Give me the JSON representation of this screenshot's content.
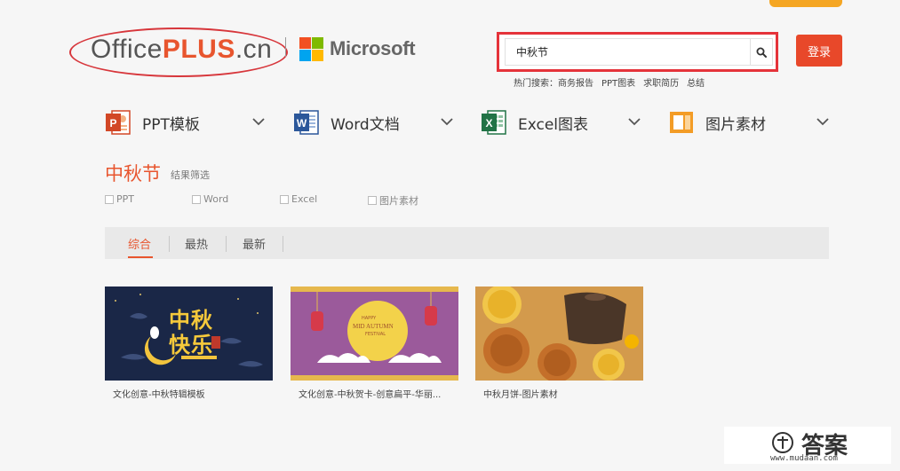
{
  "header": {
    "logo": {
      "office": "Office",
      "plus": "PLUS",
      "cn": ".cn"
    },
    "microsoft_label": "Microsoft",
    "search": {
      "value": "中秋节"
    },
    "hot_searches": {
      "label": "热门搜索：",
      "items": [
        "商务报告",
        "PPT图表",
        "求职简历",
        "总结"
      ]
    },
    "login_label": "登录"
  },
  "categories": [
    {
      "label": "PPT模板",
      "icon": "powerpoint-icon"
    },
    {
      "label": "Word文档",
      "icon": "word-icon"
    },
    {
      "label": "Excel图表",
      "icon": "excel-icon"
    },
    {
      "label": "图片素材",
      "icon": "image-material-icon"
    }
  ],
  "results": {
    "title": "中秋节",
    "subtitle": "结果筛选",
    "filters": [
      "PPT",
      "Word",
      "Excel",
      "图片素材"
    ],
    "tabs": [
      "综合",
      "最热",
      "最新"
    ],
    "active_tab": "综合",
    "cards": [
      {
        "label": "文化创意-中秋特辑模板",
        "thumb_text_1": "中秋",
        "thumb_text_2": "快乐"
      },
      {
        "label": "文化创意-中秋贺卡-创意扁平-华丽...",
        "thumb_text_1": "HAPPY",
        "thumb_text_2": "MID AUTUMN",
        "thumb_text_3": "FESTIVAL"
      },
      {
        "label": "中秋月饼-图片素材"
      }
    ]
  },
  "watermark": {
    "text": "答案",
    "url": "www.mudaan.com"
  },
  "colors": {
    "accent": "#e8552e",
    "highlight": "#e5333a",
    "login": "#e8482a"
  }
}
